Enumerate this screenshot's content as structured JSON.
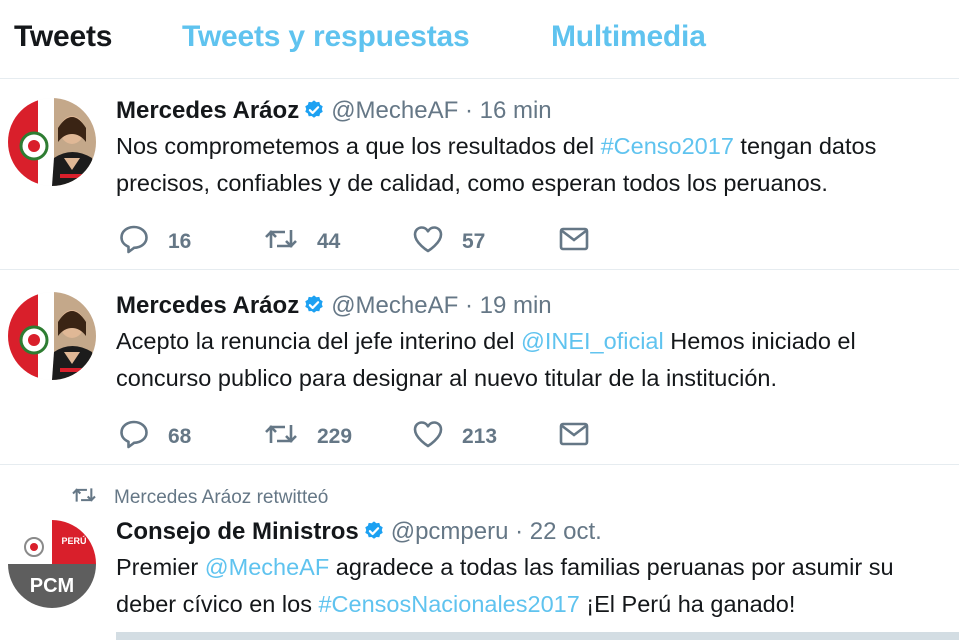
{
  "tabs": [
    {
      "label": "Tweets",
      "active": true
    },
    {
      "label": "Tweets y respuestas",
      "active": false
    },
    {
      "label": "Multimedia",
      "active": false
    }
  ],
  "tweets": [
    {
      "name": "Mercedes Aráoz",
      "handle": "@MecheAF",
      "dot": "·",
      "time": "16 min",
      "text_parts": [
        "Nos comprometemos a que los resultados del ",
        "#Censo2017",
        " tengan datos precisos, confiables y de calidad, como esperan todos los peruanos."
      ],
      "replies": "16",
      "retweets": "44",
      "likes": "57"
    },
    {
      "name": "Mercedes Aráoz",
      "handle": "@MecheAF",
      "dot": "·",
      "time": "19 min",
      "text_parts": [
        "Acepto la renuncia del jefe interino del ",
        "@INEI_oficial",
        " Hemos iniciado el concurso publico para designar al nuevo titular de la institución."
      ],
      "replies": "68",
      "retweets": "229",
      "likes": "213"
    },
    {
      "retweet_context": "Mercedes Aráoz retwitteó",
      "name": "Consejo de Ministros",
      "handle": "@pcmperu",
      "dot": "·",
      "time": "22 oct.",
      "text_parts": [
        "Premier ",
        "@MecheAF",
        " agradece a todas las familias peruanas por asumir su deber cívico en los ",
        "#CensosNacionales2017",
        " ¡El Perú ha ganado!"
      ],
      "avatar_label": "PCM",
      "avatar_flag_label": "PERÚ"
    }
  ],
  "colors": {
    "link": "#5fc3ef",
    "text": "#14171a",
    "muted": "#657786",
    "verified": "#1da1f2",
    "divider": "#e6ecf0"
  },
  "icons": {
    "reply": "reply-icon",
    "retweet": "retweet-icon",
    "like": "heart-icon",
    "message": "envelope-icon",
    "verified": "verified-badge-icon"
  }
}
